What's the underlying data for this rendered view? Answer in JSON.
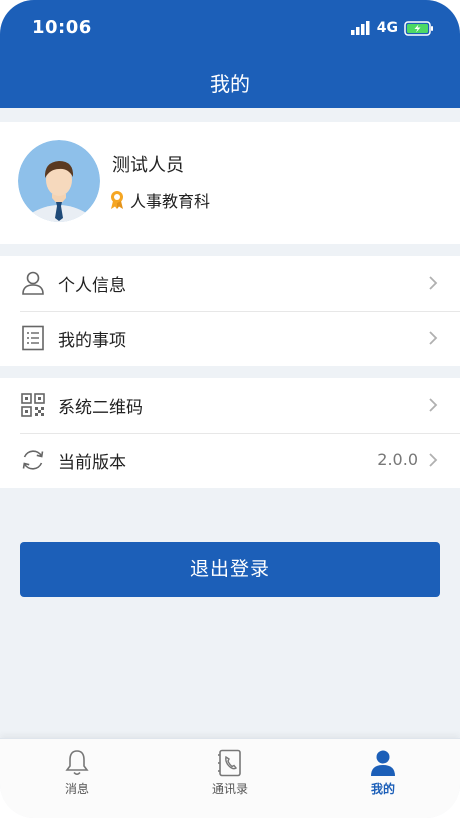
{
  "status_bar": {
    "time": "10:06",
    "network": "4G"
  },
  "header": {
    "title": "我的"
  },
  "profile": {
    "name": "测试人员",
    "department": "人事教育科"
  },
  "menu_group_1": [
    {
      "label": "个人信息",
      "icon": "user-icon"
    },
    {
      "label": "我的事项",
      "icon": "list-document-icon"
    }
  ],
  "menu_group_2": [
    {
      "label": "系统二维码",
      "icon": "qrcode-icon"
    },
    {
      "label": "当前版本",
      "icon": "refresh-icon",
      "value": "2.0.0"
    }
  ],
  "logout_label": "退出登录",
  "tabs": [
    {
      "label": "消息",
      "icon": "bell-icon"
    },
    {
      "label": "通讯录",
      "icon": "contacts-book-icon"
    },
    {
      "label": "我的",
      "icon": "person-icon",
      "active": true
    }
  ],
  "colors": {
    "primary": "#1c5fb8",
    "background": "#eef2f6",
    "badge": "#f5a623"
  }
}
